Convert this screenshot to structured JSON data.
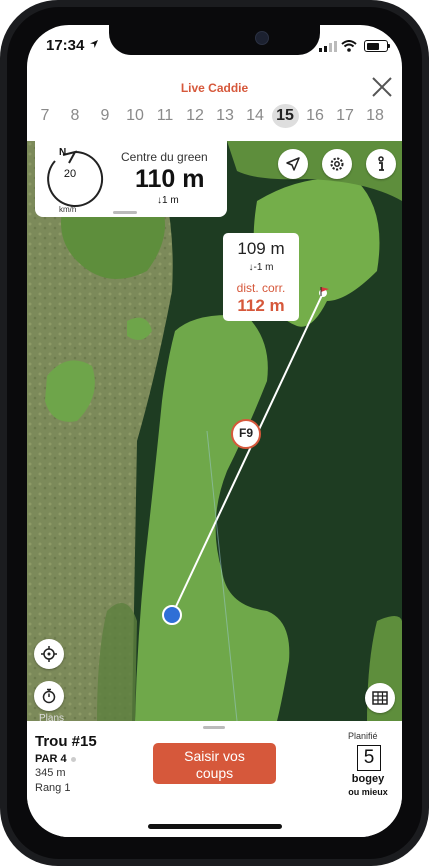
{
  "status_bar": {
    "time": "17:34"
  },
  "header": {
    "title": "Live Caddie",
    "holes": [
      "7",
      "8",
      "9",
      "10",
      "11",
      "12",
      "13",
      "14",
      "15",
      "16",
      "17",
      "18"
    ],
    "active_hole": "15"
  },
  "info_card": {
    "wind_speed": "20",
    "wind_unit": "km/h",
    "wind_dir_label": "N",
    "target_label": "Centre du green",
    "distance": "110 m",
    "elevation": "↓1 m"
  },
  "distance_box": {
    "distance": "109 m",
    "elevation": "↓-1 m",
    "corrected_label": "dist. corr.",
    "corrected_distance": "112 m"
  },
  "club": {
    "label": "F9"
  },
  "map": {
    "legal": "Plans"
  },
  "bottom": {
    "hole_title": "Trou #15",
    "par": "PAR 4",
    "length": "345 m",
    "rank": "Rang 1",
    "enter_button": "Saisir vos coups",
    "planned_label": "Planifié",
    "planned_value": "5",
    "planned_text1": "bogey",
    "planned_text2": "ou mieux"
  },
  "colors": {
    "accent": "#d6583b",
    "water": "#1c3d1f",
    "fairway": "#6fa84a"
  },
  "icons": [
    "location-arrow-icon",
    "close-icon",
    "compass-wind-icon",
    "navigation-icon",
    "gear-icon",
    "info-icon",
    "crosshair-icon",
    "stopwatch-icon",
    "scorecard-icon",
    "flag-icon"
  ]
}
